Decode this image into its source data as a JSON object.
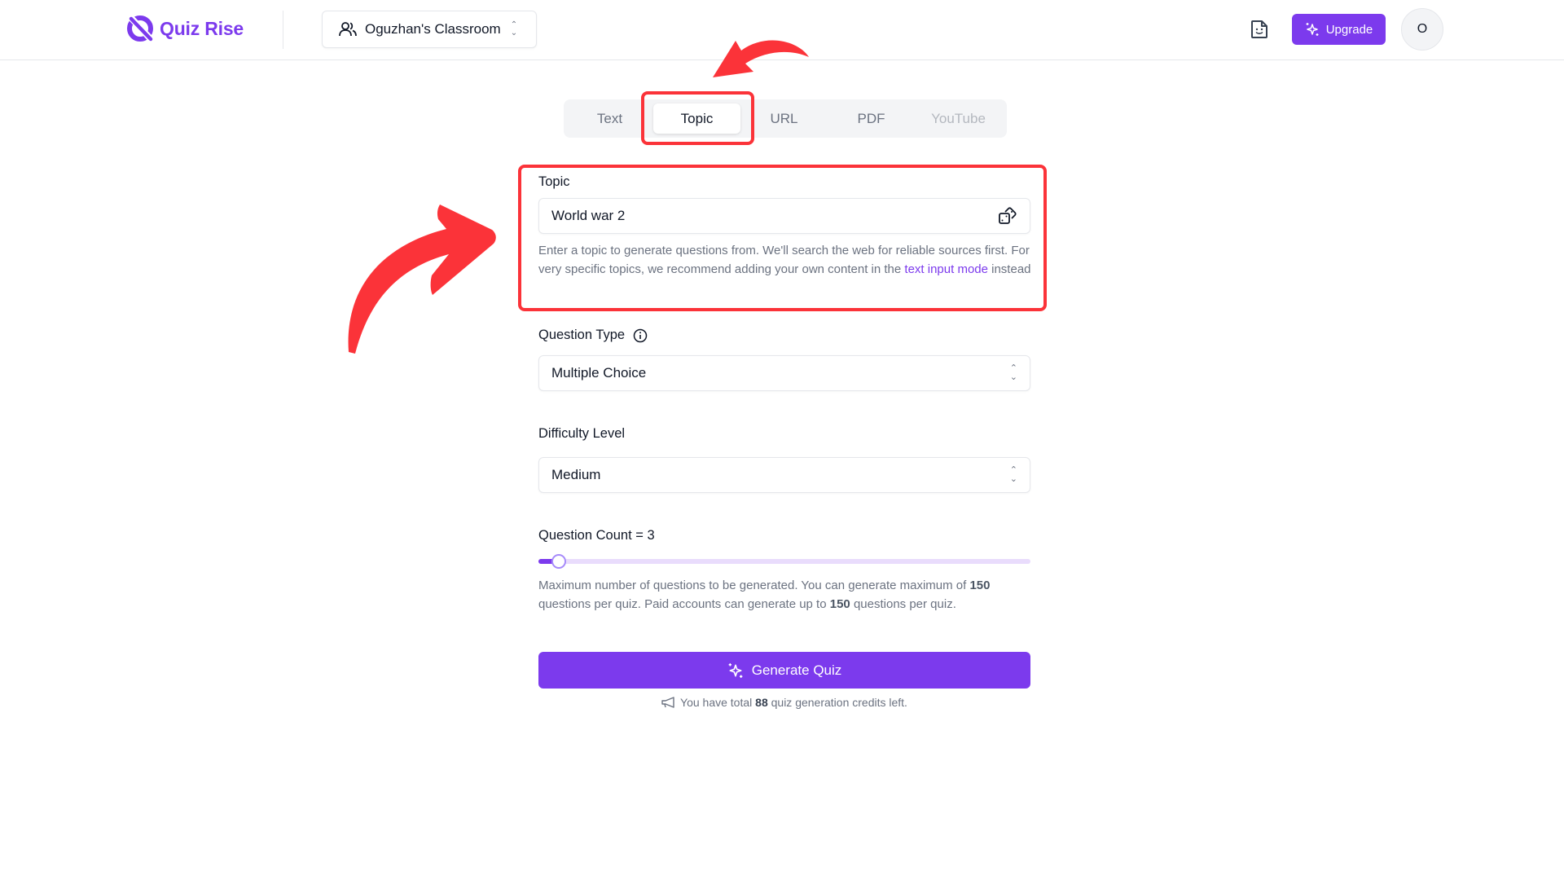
{
  "header": {
    "brand": "Quiz Rise",
    "classroom": "Oguzhan's Classroom",
    "upgrade_label": "Upgrade",
    "avatar_initial": "O"
  },
  "tabs": [
    {
      "label": "Text",
      "state": "default"
    },
    {
      "label": "Topic",
      "state": "active"
    },
    {
      "label": "URL",
      "state": "default"
    },
    {
      "label": "PDF",
      "state": "default"
    },
    {
      "label": "YouTube",
      "state": "disabled"
    }
  ],
  "form": {
    "topic": {
      "label": "Topic",
      "value": "World war 2",
      "help_before": "Enter a topic to generate questions from. We'll search the web for reliable sources first. For very specific topics, we recommend adding your own content in the ",
      "help_link": "text input mode",
      "help_after": " instead"
    },
    "question_type": {
      "label": "Question Type",
      "value": "Multiple Choice"
    },
    "difficulty": {
      "label": "Difficulty Level",
      "value": "Medium"
    },
    "question_count": {
      "label": "Question Count = 3",
      "value": 3,
      "min": 1,
      "max": 150,
      "help_1": "Maximum number of questions to be generated. You can generate maximum of ",
      "help_max": "150",
      "help_2": " questions per quiz. Paid accounts can generate up to ",
      "help_paid_max": "150",
      "help_3": " questions per quiz."
    },
    "generate_label": "Generate Quiz",
    "credits_before": "You have total ",
    "credits_value": "88",
    "credits_after": " quiz generation credits left."
  },
  "colors": {
    "accent": "#7c3aed",
    "annotation": "#fb3339"
  }
}
